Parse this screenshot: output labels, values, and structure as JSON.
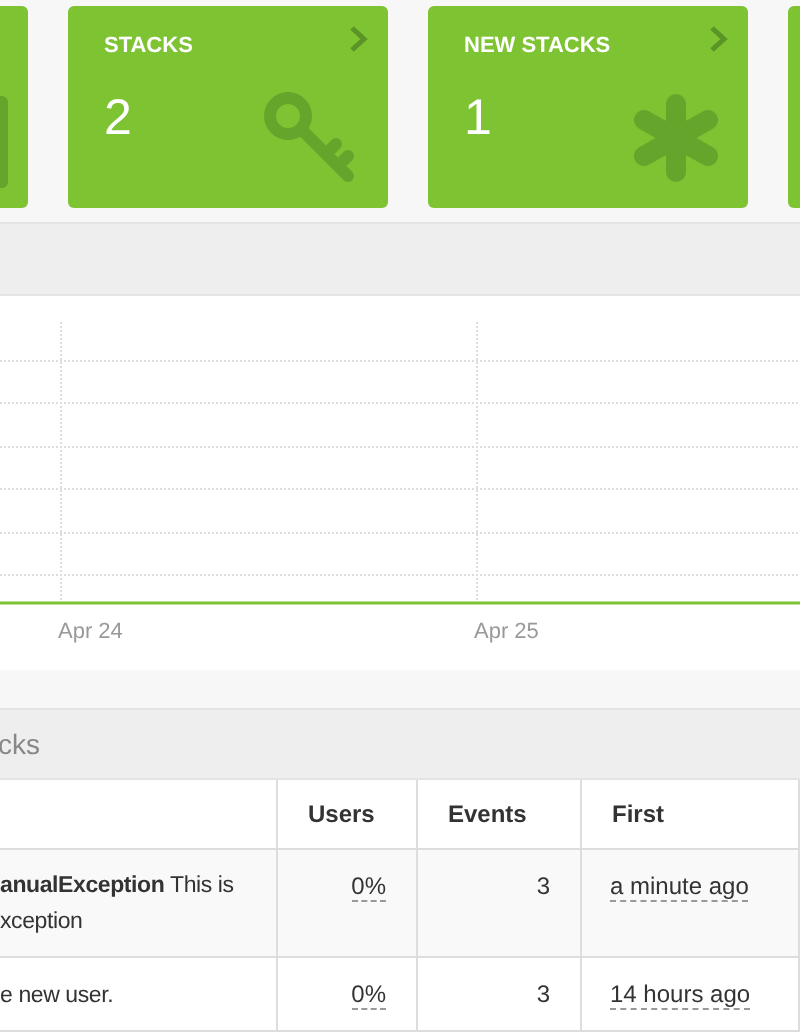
{
  "cards": [
    {
      "kind": "partial-left"
    },
    {
      "kind": "key-card",
      "title": "STACKS",
      "value": "2"
    },
    {
      "kind": "asterisk-card",
      "title": "NEW STACKS",
      "value": "1"
    },
    {
      "kind": "partial-right"
    }
  ],
  "chart": {
    "x_labels": [
      "Apr 24",
      "Apr 25"
    ]
  },
  "stacks_panel": {
    "title": "cks",
    "columns": [
      "",
      "Users",
      "Events",
      "First"
    ],
    "rows": [
      {
        "summary": "**anualException** This is\nxception",
        "users": "0%",
        "events": "3",
        "first": "a minute ago"
      },
      {
        "summary": "e new user.",
        "users": "0%",
        "events": "3",
        "first": "14 hours ago"
      }
    ]
  }
}
